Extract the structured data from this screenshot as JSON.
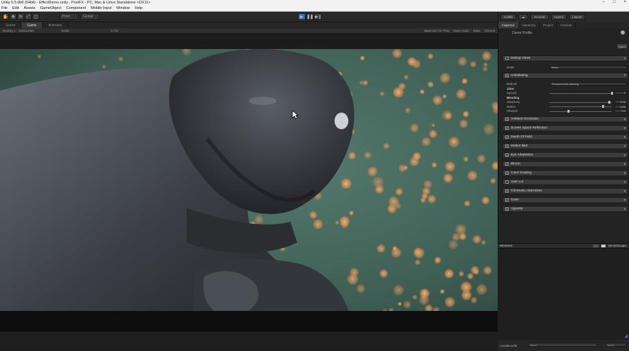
{
  "window": {
    "title": "Unity 5.5.0b6 (64bit) - EffectDemo.unity - PostFX - PC, Mac & Linux Standalone <DX11>",
    "controls": [
      "–",
      "□",
      "×"
    ]
  },
  "menu": {
    "items": [
      "File",
      "Edit",
      "Assets",
      "GameObject",
      "Component",
      "Mobile Input",
      "Window",
      "Help"
    ]
  },
  "toolbar": {
    "pivot_label": "Pivot",
    "global_label": "Global",
    "play_icon": "play-icon",
    "pause_icon": "pause-icon",
    "step_icon": "step-icon",
    "collab_label": "Collab",
    "account_label": "Account",
    "layers_label": "Layers",
    "layout_label": "Layout"
  },
  "scene_tabs": [
    {
      "label": "Scene",
      "active": false
    },
    {
      "label": "Game",
      "active": true
    },
    {
      "label": "Animator",
      "active": false
    }
  ],
  "game_toolbar": {
    "display": "Display 1",
    "resolution": "1920x1080",
    "scale_label": "Scale",
    "scale_value": "0.73x",
    "maximize": "Maximize On Play",
    "mute": "Mute Audio",
    "stats": "Stats",
    "gizmos": "Gizmos"
  },
  "inspector": {
    "tabs": [
      {
        "label": "Inspector",
        "active": true
      },
      {
        "label": "Hierarchy",
        "active": false
      },
      {
        "label": "Project",
        "active": false
      },
      {
        "label": "Console",
        "active": false
      }
    ],
    "profile_title": "Demo Profile",
    "open_label": "Open",
    "effects": [
      {
        "label": "Debug Views",
        "checked": false,
        "expanded": true,
        "rows": [
          {
            "label": "Mode",
            "type": "field",
            "value": "None"
          }
        ]
      },
      {
        "label": "Antialiasing",
        "checked": true,
        "expanded": true,
        "rows": [
          {
            "label": "Method",
            "type": "field",
            "value": "Temporal Anti-aliasing"
          },
          {
            "label": "Jitter",
            "type": "heading"
          },
          {
            "label": "Spread",
            "type": "slider",
            "value": "1"
          },
          {
            "label": "Blending",
            "type": "heading"
          },
          {
            "label": "Stationary",
            "type": "slider",
            "value": "0.95"
          },
          {
            "label": "Motion",
            "type": "slider",
            "value": "0.85"
          },
          {
            "label": "Sharpen",
            "type": "slider",
            "value": "0.3"
          }
        ]
      },
      {
        "label": "Ambient Occlusion",
        "checked": true
      },
      {
        "label": "Screen Space Reflection",
        "checked": true
      },
      {
        "label": "Depth Of Field",
        "checked": true
      },
      {
        "label": "Motion Blur",
        "checked": true
      },
      {
        "label": "Eye Adaptation",
        "checked": true
      },
      {
        "label": "Bloom",
        "checked": true
      },
      {
        "label": "Color Grading",
        "checked": true
      },
      {
        "label": "User Lut",
        "checked": false
      },
      {
        "label": "Chromatic Aberration",
        "checked": true
      },
      {
        "label": "Grain",
        "checked": true
      },
      {
        "label": "Vignette",
        "checked": true
      }
    ]
  },
  "preview": {
    "label": "Monitors",
    "right_label": "Vectorscope"
  },
  "assetbundle": {
    "label": "AssetBundle",
    "value": "None",
    "variant": "None"
  },
  "colors": {
    "unity_dark": "#232323",
    "accent_blue": "#3a6fb0",
    "scene_bg": "#4b6b5f",
    "bokeh": "#e8a060"
  }
}
